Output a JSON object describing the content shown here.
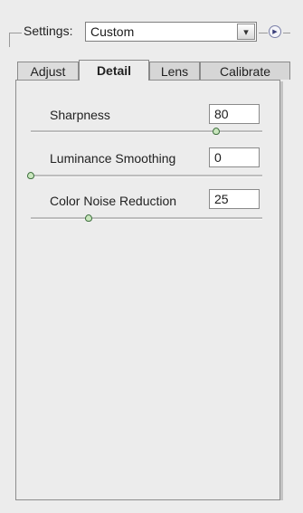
{
  "settings": {
    "label": "Settings:",
    "selected": "Custom",
    "arrow_glyph": "▾",
    "flyout_glyph": "▶"
  },
  "tabs": [
    {
      "label": "Adjust",
      "active": false
    },
    {
      "label": "Detail",
      "active": true
    },
    {
      "label": "Lens",
      "active": false
    },
    {
      "label": "Calibrate",
      "active": false
    }
  ],
  "controls": [
    {
      "label": "Sharpness",
      "value": "80",
      "level": 0.8
    },
    {
      "label": "Luminance Smoothing",
      "value": "0",
      "level": 0.0
    },
    {
      "label": "Color Noise Reduction",
      "value": "25",
      "level": 0.25
    }
  ],
  "colors": {
    "background": "#ececec",
    "slider_thumb": "#c9e6bd",
    "flyout": "#3a3f7a"
  }
}
